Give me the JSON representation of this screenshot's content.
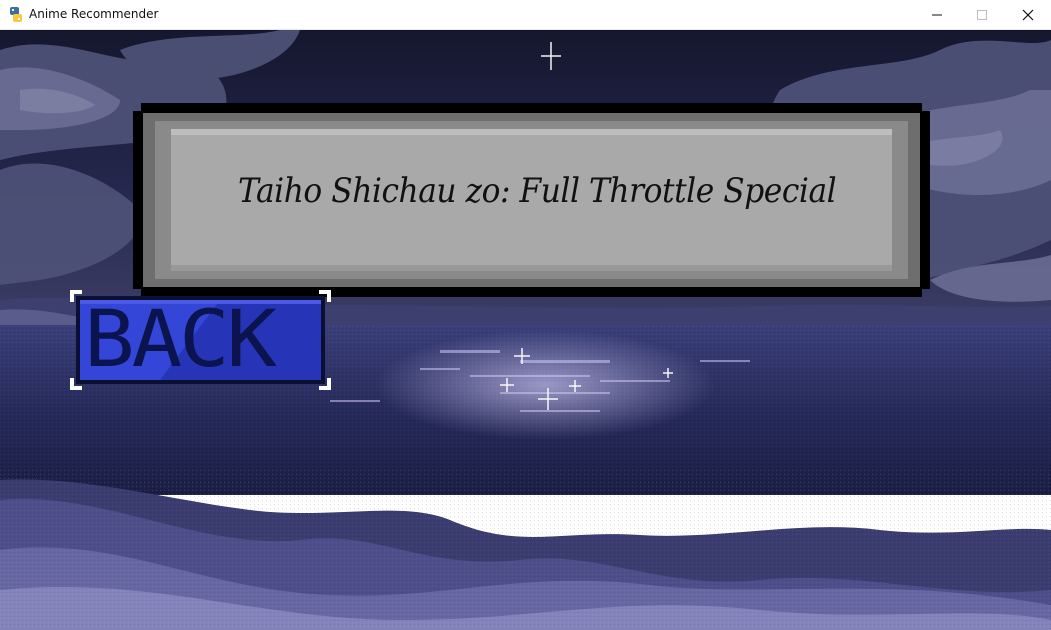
{
  "window": {
    "title": "Anime Recommender",
    "app_icon": "python-icon",
    "controls": {
      "minimize_icon": "minimize-icon",
      "maximize_icon": "maximize-icon",
      "close_icon": "close-icon"
    }
  },
  "scene": {
    "background": "pixel-art night ocean with clouds, stars and sand dunes"
  },
  "banner": {
    "title": "Taiho Shichau zo: Full Throttle Special"
  },
  "back_button": {
    "label": "BACK"
  },
  "colors": {
    "sky": "#1a1d3a",
    "cloud": "#5b5f82",
    "sea": "#2b2f63",
    "dune": "#4a4a80",
    "banner_fill": "#a9a9a9",
    "banner_border": "#000000",
    "button_blue": "#2733c4",
    "button_text": "#0c1450"
  }
}
